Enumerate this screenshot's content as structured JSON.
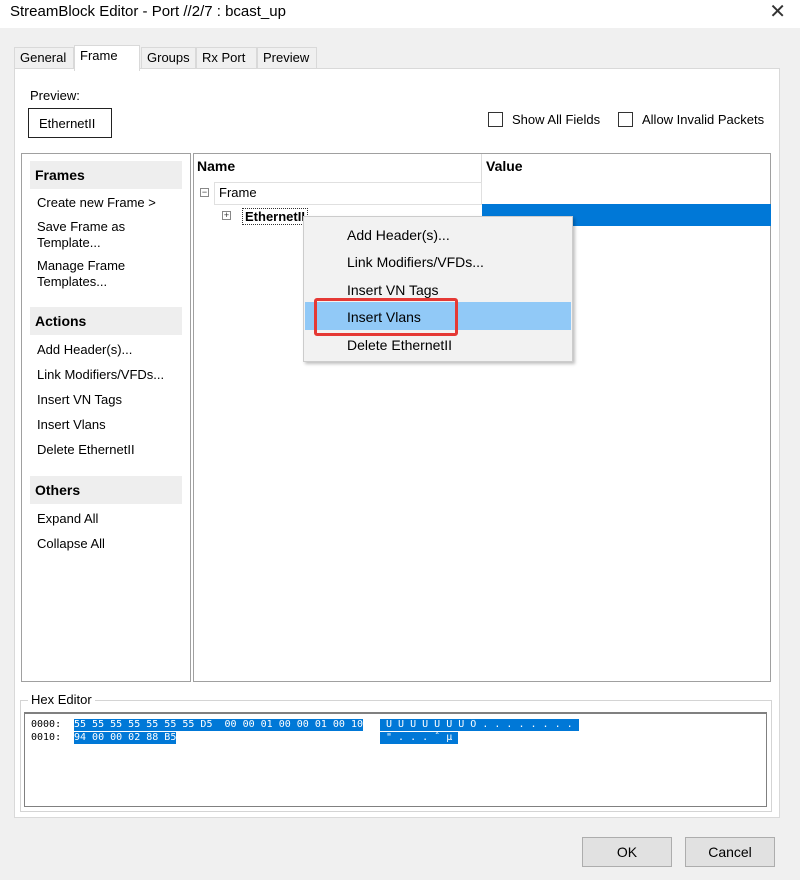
{
  "window": {
    "title": "StreamBlock Editor - Port //2/7 : bcast_up",
    "close_glyph": "✕"
  },
  "tabs": [
    {
      "label": "General"
    },
    {
      "label": "Frame",
      "active": true
    },
    {
      "label": "Groups"
    },
    {
      "label": "Rx Port"
    },
    {
      "label": "Preview"
    }
  ],
  "preview": {
    "label": "Preview:",
    "value": "EthernetII"
  },
  "checkboxes": {
    "show_all_fields": "Show All Fields",
    "allow_invalid": "Allow Invalid Packets"
  },
  "sidebar": {
    "frames_header": "Frames",
    "frames_items": [
      "Create new Frame >",
      "Save Frame as\nTemplate...",
      "Manage Frame\nTemplates..."
    ],
    "actions_header": "Actions",
    "actions_items": [
      "Add Header(s)...",
      "Link Modifiers/VFDs...",
      "Insert VN Tags",
      "Insert Vlans",
      "Delete EthernetII"
    ],
    "others_header": "Others",
    "others_items": [
      "Expand All",
      "Collapse All"
    ]
  },
  "tree": {
    "col_name": "Name",
    "col_value": "Value",
    "root": "Frame",
    "child": "EthernetII",
    "collapse_glyph": "−",
    "expand_glyph": "+"
  },
  "context_menu": {
    "items": [
      "Add Header(s)...",
      "Link Modifiers/VFDs...",
      "Insert VN Tags",
      "Insert Vlans",
      "Delete EthernetII"
    ],
    "highlighted": "Insert Vlans"
  },
  "hex_editor": {
    "label": "Hex Editor",
    "rows": [
      {
        "offset": "0000:",
        "hex": "55 55 55 55 55 55 55 D5  00 00 01 00 00 01 00 10",
        "ascii": " U U U U U U U Õ . . . . . . . . "
      },
      {
        "offset": "0010:",
        "hex": "94 00 00 02 88 B5",
        "ascii": " \" . . . ˆ µ "
      }
    ]
  },
  "buttons": {
    "ok": "OK",
    "cancel": "Cancel"
  },
  "colors": {
    "selection": "#0078d7",
    "menu_highlight": "#91c9f7",
    "callout": "#e53935"
  }
}
